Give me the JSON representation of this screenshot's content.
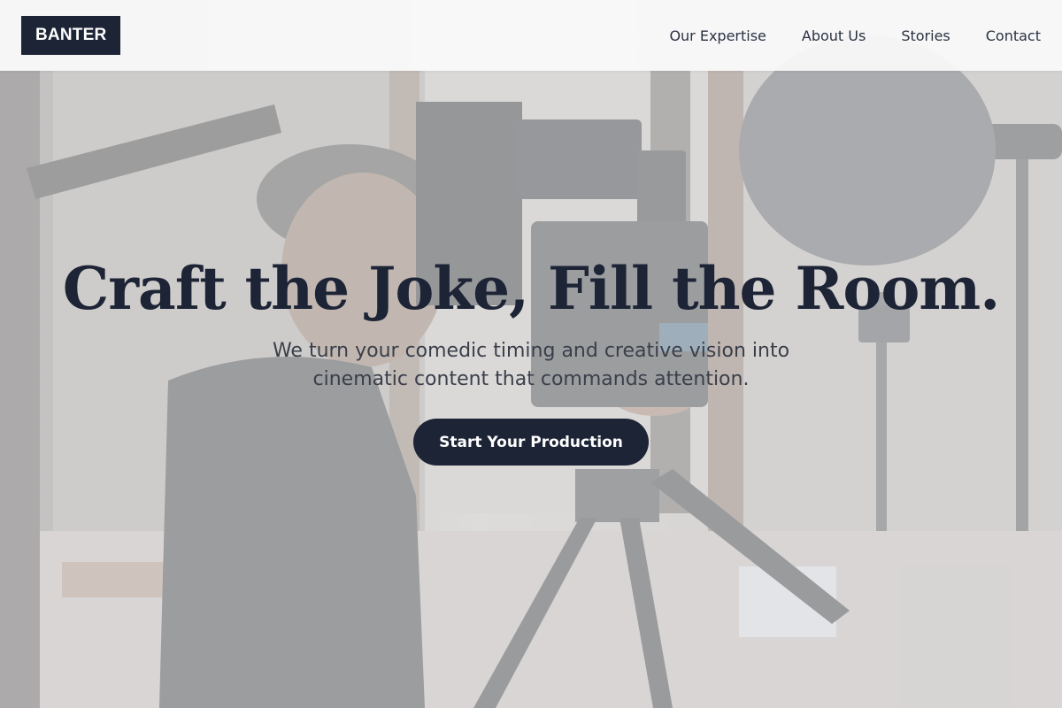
{
  "header": {
    "logo": "BANTER",
    "nav": [
      {
        "label": "Our Expertise"
      },
      {
        "label": "About Us"
      },
      {
        "label": "Stories"
      },
      {
        "label": "Contact"
      }
    ]
  },
  "hero": {
    "headline": "Craft the Joke, Fill the Room.",
    "subtitle": "We turn your comedic timing and creative vision into cinematic content that commands attention.",
    "cta_label": "Start Your Production",
    "background_image": "camera-operator-photo"
  },
  "colors": {
    "brand_dark": "#1d2436",
    "button_text": "#ffffff",
    "nav_text": "#2b3142"
  }
}
